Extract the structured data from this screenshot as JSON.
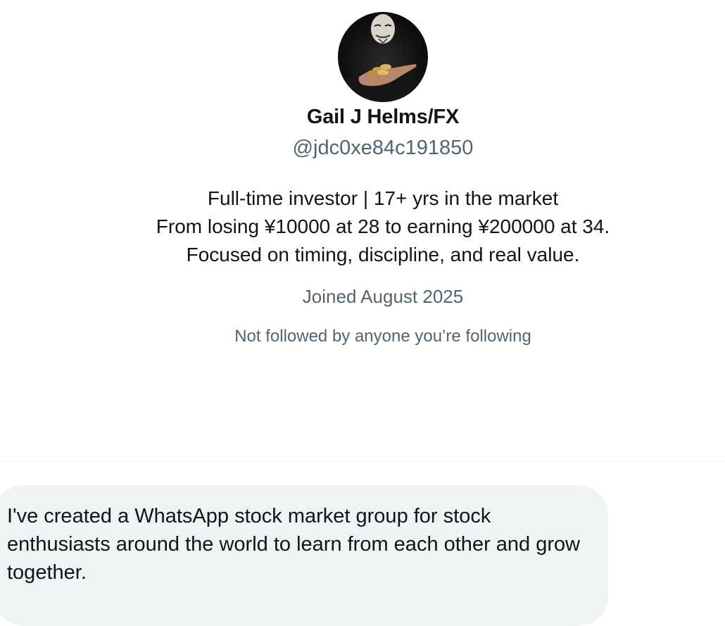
{
  "profile": {
    "display_name": "Gail J Helms/FX",
    "handle": "@jdc0xe84c191850",
    "bio_lines": [
      "Full-time investor | 17+ yrs in the market",
      "From losing ¥10000 at 28 to earning ¥200000 at 34.",
      "Focused on timing, discipline, and real value."
    ],
    "joined": "Joined August 2025",
    "followed_by": "Not followed by anyone you’re following",
    "avatar_icon": "masked-figure-with-coins"
  },
  "message": {
    "text": "I've created a WhatsApp stock market group for stock enthusiasts around the world to learn from each other and grow together."
  },
  "colors": {
    "primary_text": "#0f1419",
    "secondary_text": "#536471",
    "bubble_background": "#eff3f4",
    "divider": "#eff3f4"
  }
}
